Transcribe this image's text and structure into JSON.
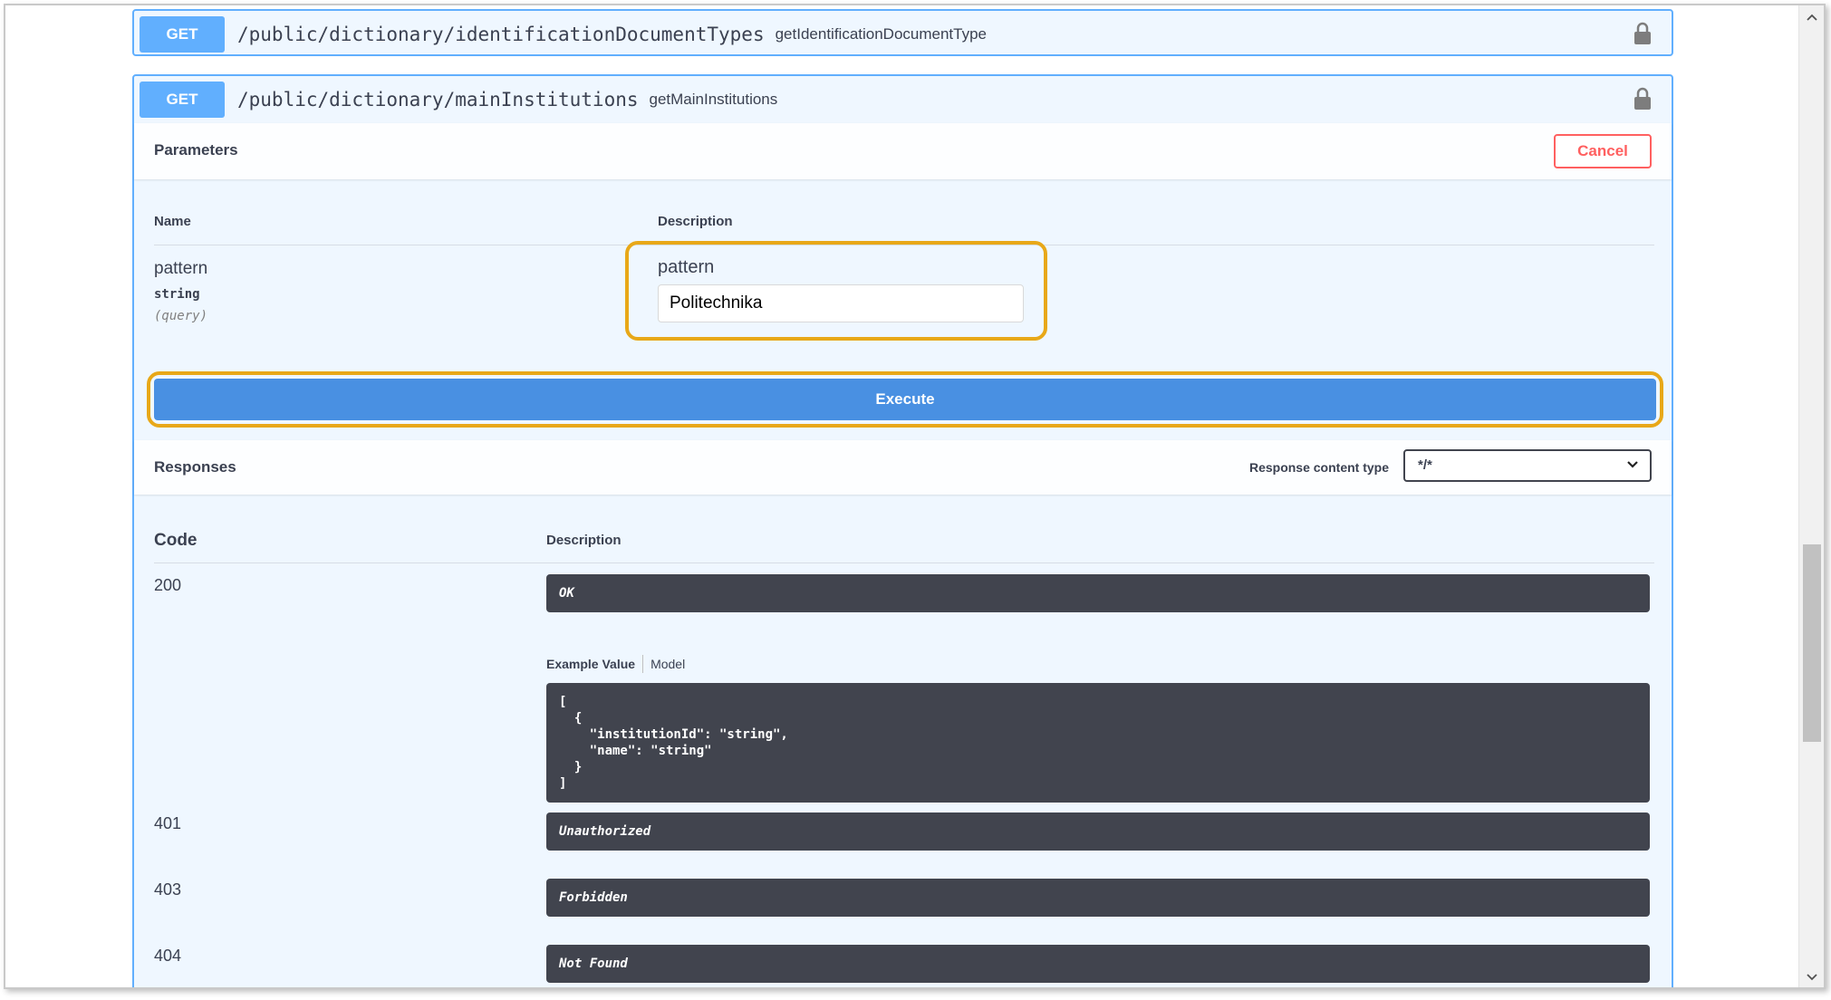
{
  "ops": [
    {
      "method": "GET",
      "path": "/public/dictionary/identificationDocumentTypes",
      "operation_id": "getIdentificationDocumentType"
    },
    {
      "method": "GET",
      "path": "/public/dictionary/mainInstitutions",
      "operation_id": "getMainInstitutions",
      "parameters_title": "Parameters",
      "cancel_label": "Cancel",
      "param_name_header": "Name",
      "param_desc_header": "Description",
      "param": {
        "name": "pattern",
        "type": "string",
        "in": "(query)",
        "label": "pattern",
        "value": "Politechnika"
      },
      "execute_label": "Execute",
      "responses_title": "Responses",
      "response_content_type_label": "Response content type",
      "response_content_type_value": "*/*",
      "resp_code_header": "Code",
      "resp_desc_header": "Description",
      "responses": [
        {
          "code": "200",
          "description": "OK"
        },
        {
          "code": "401",
          "description": "Unauthorized"
        },
        {
          "code": "403",
          "description": "Forbidden"
        },
        {
          "code": "404",
          "description": "Not Found"
        }
      ],
      "example_tabs": {
        "active": "Example Value",
        "other": "Model"
      },
      "example_lines": [
        "[",
        "  {",
        "    \"institutionId\": \"string\",",
        "    \"name\": \"string\"",
        "  }",
        "]"
      ]
    }
  ],
  "colors": {
    "get_blue": "#61affe",
    "opblock_bg": "#eff7ff",
    "execute_blue": "#4990e2",
    "cancel_red": "#ff6060",
    "highlight_orange": "#e8a818",
    "code_bg": "#41444e"
  },
  "icons": [
    "lock-icon",
    "chevron-down-icon",
    "scroll-up-arrow-icon",
    "scroll-down-arrow-icon"
  ]
}
